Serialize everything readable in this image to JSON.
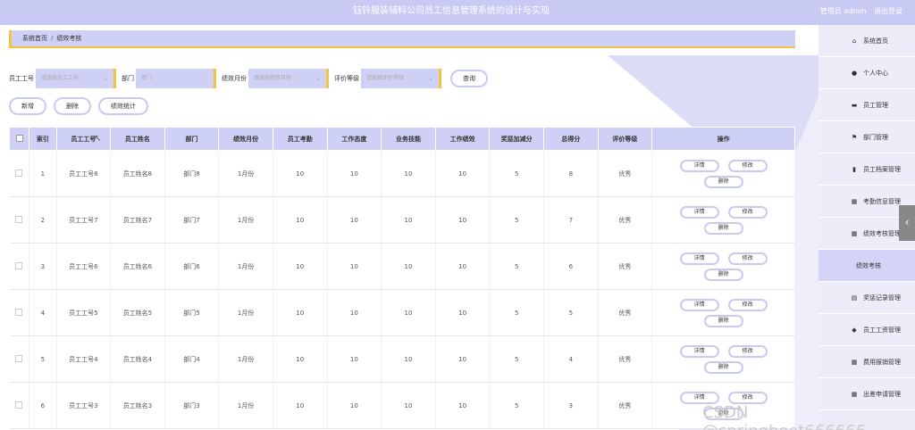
{
  "header": {
    "title": "钰铃服装辅料公司员工信息管理系统的设计与实现",
    "user_label": "管理员 admin",
    "logout": "退出登录"
  },
  "breadcrumb": {
    "home": "系统首页",
    "separator": "/",
    "current": "绩效考核"
  },
  "search": {
    "fields": [
      {
        "label": "员工工号",
        "placeholder": "请选择员工工号",
        "dropdown": true
      },
      {
        "label": "部门",
        "placeholder": "部门",
        "dropdown": false
      },
      {
        "label": "绩效月份",
        "placeholder": "请选择绩效月份",
        "dropdown": true
      },
      {
        "label": "评价等级",
        "placeholder": "请选择评价等级",
        "dropdown": true
      }
    ],
    "query_button": "查询"
  },
  "actions": {
    "add": "新增",
    "delete": "删除",
    "stats": "绩效统计"
  },
  "table": {
    "columns": [
      "索引",
      "员工工号",
      "员工姓名",
      "部门",
      "绩效月份",
      "员工考勤",
      "工作态度",
      "业务技能",
      "工作绩效",
      "奖惩加减分",
      "总得分",
      "评价等级",
      "操作"
    ],
    "rows": [
      [
        "1",
        "员工工号8",
        "员工姓名8",
        "部门8",
        "1月份",
        "10",
        "10",
        "10",
        "10",
        "5",
        "8",
        "优秀"
      ],
      [
        "2",
        "员工工号7",
        "员工姓名7",
        "部门7",
        "1月份",
        "10",
        "10",
        "10",
        "10",
        "5",
        "7",
        "优秀"
      ],
      [
        "3",
        "员工工号6",
        "员工姓名6",
        "部门6",
        "1月份",
        "10",
        "10",
        "10",
        "10",
        "5",
        "6",
        "优秀"
      ],
      [
        "4",
        "员工工号5",
        "员工姓名5",
        "部门5",
        "1月份",
        "10",
        "10",
        "10",
        "10",
        "5",
        "5",
        "优秀"
      ],
      [
        "5",
        "员工工号4",
        "员工姓名4",
        "部门4",
        "1月份",
        "10",
        "10",
        "10",
        "10",
        "5",
        "4",
        "优秀"
      ],
      [
        "6",
        "员工工号3",
        "员工姓名3",
        "部门3",
        "1月份",
        "10",
        "10",
        "10",
        "10",
        "5",
        "3",
        "优秀"
      ]
    ],
    "row_ops": {
      "detail": "详情",
      "edit": "修改",
      "delete": "删除"
    }
  },
  "sidebar": {
    "items": [
      {
        "label": "系统首页",
        "icon": "home-icon",
        "glyph": "⌂"
      },
      {
        "label": "个人中心",
        "icon": "user-icon",
        "glyph": "●"
      },
      {
        "label": "员工管理",
        "icon": "card-icon",
        "glyph": "▬"
      },
      {
        "label": "部门管理",
        "icon": "flag-icon",
        "glyph": "⚑"
      },
      {
        "label": "员工档案管理",
        "icon": "bar-chart-icon",
        "glyph": "▮"
      },
      {
        "label": "考勤信息管理",
        "icon": "grid-icon",
        "glyph": "▦"
      },
      {
        "label": "绩效考核管理",
        "icon": "grid-icon",
        "glyph": "▦"
      },
      {
        "label": "绩效考核",
        "icon": "",
        "glyph": "",
        "sub": true
      },
      {
        "label": "奖惩记录管理",
        "icon": "clipboard-icon",
        "glyph": "▤"
      },
      {
        "label": "员工工资管理",
        "icon": "location-icon",
        "glyph": "◆"
      },
      {
        "label": "费用报销管理",
        "icon": "grid-icon",
        "glyph": "▦"
      },
      {
        "label": "出差申请管理",
        "icon": "grid-icon",
        "glyph": "▦"
      }
    ]
  },
  "watermark": "CSDN @springboot666666",
  "collapse_handle": "‹"
}
